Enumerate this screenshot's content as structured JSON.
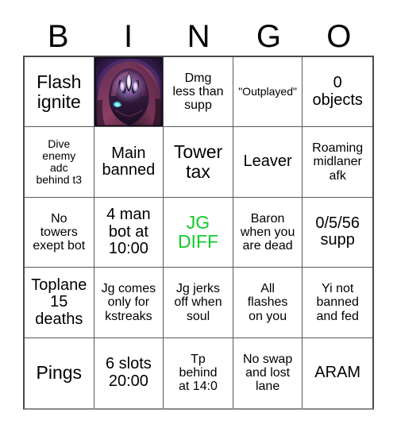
{
  "header": {
    "letters": [
      "B",
      "I",
      "N",
      "G",
      "O"
    ]
  },
  "colors": {
    "accent_green": "#11cc2b",
    "grid_line": "#5a5a5a",
    "grid_border": "#4a4a4a",
    "text": "#000000",
    "background": "#ffffff"
  },
  "grid": {
    "rows": 5,
    "columns": 5,
    "cells": [
      {
        "id": "b1",
        "text": "Flash\nignite",
        "size": "lg",
        "type": "text"
      },
      {
        "id": "i1",
        "text": "",
        "size": "md",
        "type": "image",
        "icon": "champion-portrait-icon"
      },
      {
        "id": "n1",
        "text": "Dmg\nless than\nsupp",
        "size": "sm",
        "type": "text"
      },
      {
        "id": "g1",
        "text": "\"Outplayed\"",
        "size": "xs",
        "type": "text"
      },
      {
        "id": "o1",
        "text": "0\nobjects",
        "size": "md",
        "type": "text"
      },
      {
        "id": "b2",
        "text": "Dive\nenemy\nadc\nbehind t3",
        "size": "xs",
        "type": "text"
      },
      {
        "id": "i2",
        "text": "Main\nbanned",
        "size": "md",
        "type": "text"
      },
      {
        "id": "n2",
        "text": "Tower\ntax",
        "size": "lg",
        "type": "text"
      },
      {
        "id": "g2",
        "text": "Leaver",
        "size": "md",
        "type": "text"
      },
      {
        "id": "o2",
        "text": "Roaming\nmidlaner\nafk",
        "size": "sm",
        "type": "text"
      },
      {
        "id": "b3",
        "text": "No\ntowers\nexept bot",
        "size": "sm",
        "type": "text"
      },
      {
        "id": "i3",
        "text": "4 man\nbot at\n10:00",
        "size": "md",
        "type": "text"
      },
      {
        "id": "n3",
        "text": "JG\nDIFF",
        "size": "lg",
        "type": "text",
        "color": "green"
      },
      {
        "id": "g3",
        "text": "Baron\nwhen you\nare dead",
        "size": "sm",
        "type": "text"
      },
      {
        "id": "o3",
        "text": "0/5/56\nsupp",
        "size": "md",
        "type": "text"
      },
      {
        "id": "b4",
        "text": "Toplane\n15\ndeaths",
        "size": "md",
        "type": "text"
      },
      {
        "id": "i4",
        "text": "Jg comes\nonly for\nkstreaks",
        "size": "sm",
        "type": "text"
      },
      {
        "id": "n4",
        "text": "Jg jerks\noff when\nsoul",
        "size": "sm",
        "type": "text"
      },
      {
        "id": "g4",
        "text": "All\nflashes\non you",
        "size": "sm",
        "type": "text"
      },
      {
        "id": "o4",
        "text": "Yi not\nbanned\nand fed",
        "size": "sm",
        "type": "text"
      },
      {
        "id": "b5",
        "text": "Pings",
        "size": "lg",
        "type": "text"
      },
      {
        "id": "i5",
        "text": "6 slots\n20:00",
        "size": "md",
        "type": "text"
      },
      {
        "id": "n5",
        "text": "Tp\nbehind\nat 14:0",
        "size": "sm",
        "type": "text"
      },
      {
        "id": "g5",
        "text": "No swap\nand lost\nlane",
        "size": "sm",
        "type": "text"
      },
      {
        "id": "o5",
        "text": "ARAM",
        "size": "md",
        "type": "text"
      }
    ]
  }
}
